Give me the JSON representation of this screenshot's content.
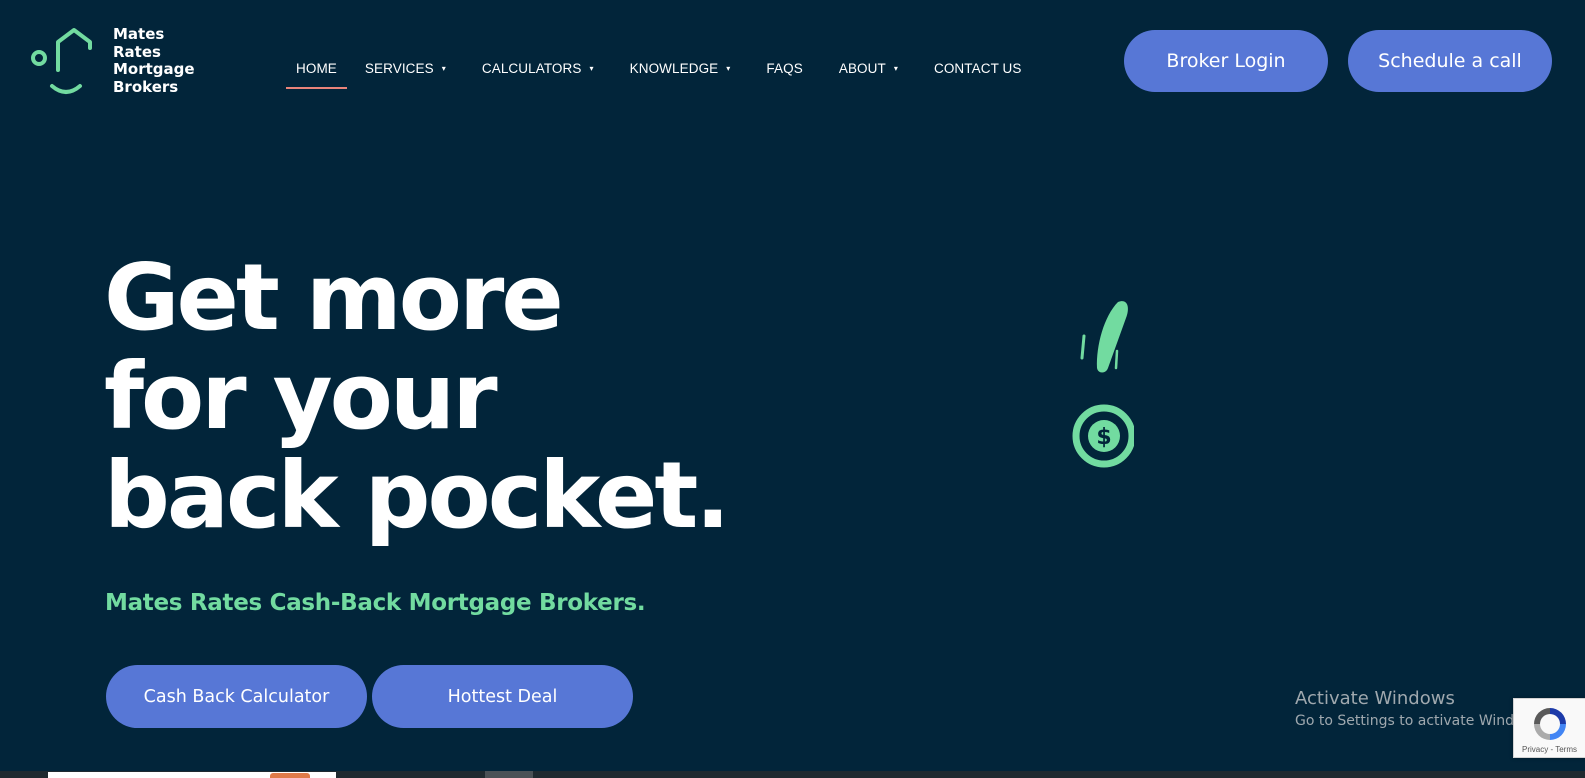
{
  "brand": {
    "name_lines": [
      "Mates",
      "Rates",
      "Mortgage",
      "Brokers"
    ],
    "accent_color": "#72dba0",
    "icon": "smiling-house-logo"
  },
  "nav": {
    "items": [
      {
        "label": "HOME",
        "active": true,
        "has_dropdown": false
      },
      {
        "label": "SERVICES",
        "active": false,
        "has_dropdown": true
      },
      {
        "label": "CALCULATORS",
        "active": false,
        "has_dropdown": true
      },
      {
        "label": "KNOWLEDGE",
        "active": false,
        "has_dropdown": true
      },
      {
        "label": "FAQS",
        "active": false,
        "has_dropdown": false
      },
      {
        "label": "ABOUT",
        "active": false,
        "has_dropdown": true
      },
      {
        "label": "CONTACT US",
        "active": false,
        "has_dropdown": false
      }
    ],
    "caret": "▾",
    "active_underline_color": "#e9847a"
  },
  "header_buttons": {
    "broker_login": "Broker Login",
    "schedule_call": "Schedule a call"
  },
  "hero": {
    "headline_lines": [
      "Get more",
      "for your",
      "back pocket."
    ],
    "subheading": "Mates Rates Cash-Back Mortgage Brokers.",
    "cta_primary": "Cash Back Calculator",
    "cta_secondary": "Hottest Deal",
    "illustration": "falling-dollar-coin-icon"
  },
  "os_overlay": {
    "activate_title": "Activate Windows",
    "activate_subtitle": "Go to Settings to activate Windows."
  },
  "recaptcha": {
    "links": "Privacy - Terms"
  },
  "colors": {
    "background": "#02253a",
    "button": "#5777d6",
    "text": "#ffffff"
  }
}
